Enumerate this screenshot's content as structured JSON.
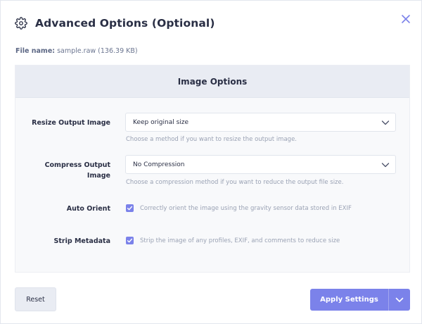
{
  "dialog": {
    "title": "Advanced Options (Optional)",
    "icons": {
      "settings": "gear-icon",
      "close": "close-icon"
    }
  },
  "file": {
    "label": "File name:",
    "value": "sample.raw (136.39 KB)"
  },
  "panel": {
    "title": "Image Options",
    "resize": {
      "label": "Resize Output Image",
      "value": "Keep original size",
      "help": "Choose a method if you want to resize the output image."
    },
    "compress": {
      "label_line1": "Compress Output",
      "label_line2": "Image",
      "value": "No Compression",
      "help": "Choose a compression method if you want to reduce the output file size."
    },
    "auto_orient": {
      "label": "Auto Orient",
      "checked": true,
      "text": "Correctly orient the image using the gravity sensor data stored in EXIF"
    },
    "strip_metadata": {
      "label": "Strip Metadata",
      "checked": true,
      "text": "Strip the image of any profiles, EXIF, and comments to reduce size"
    }
  },
  "footer": {
    "reset_label": "Reset",
    "apply_label": "Apply Settings"
  },
  "colors": {
    "accent": "#7b82ea",
    "panel_header": "#e9ecf3",
    "text": "#2a2f45",
    "muted": "#9aa2b4"
  }
}
